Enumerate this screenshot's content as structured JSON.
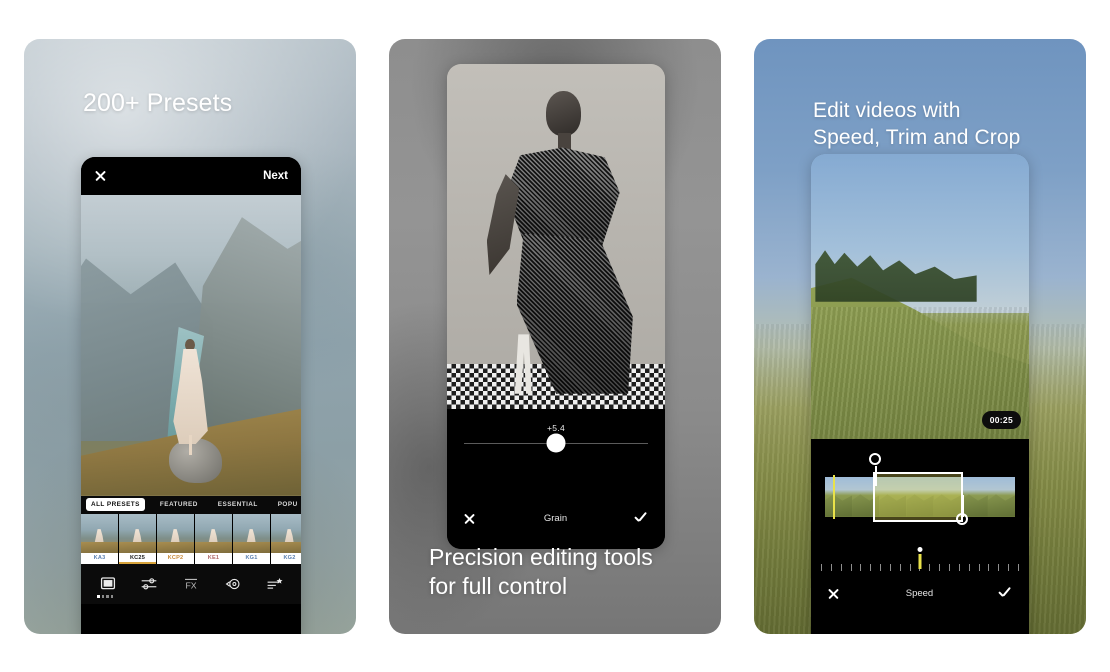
{
  "page": {
    "background": "#ffffff"
  },
  "cards": [
    {
      "id": "presets-card",
      "headline": "200+ Presets",
      "phone": {
        "topbar": {
          "close_icon": "close-icon",
          "next_label": "Next"
        },
        "photo_alt": "Woman in dress standing on rock above fjord",
        "tabs": [
          {
            "label": "ALL PRESETS",
            "active": true
          },
          {
            "label": "FEATURED",
            "active": false
          },
          {
            "label": "ESSENTIAL",
            "active": false
          },
          {
            "label": "POPU",
            "active": false
          }
        ],
        "presets": [
          {
            "label": "KA3",
            "selected": false,
            "tone": "cool"
          },
          {
            "label": "KC25",
            "selected": true,
            "tone": "neutral"
          },
          {
            "label": "KCP2",
            "selected": false,
            "tone": "warm"
          },
          {
            "label": "KE1",
            "selected": false,
            "tone": "rose"
          },
          {
            "label": "KG1",
            "selected": false,
            "tone": "cool"
          },
          {
            "label": "KG2",
            "selected": false,
            "tone": "cool"
          }
        ],
        "toolbar": [
          {
            "icon": "presets-icon"
          },
          {
            "icon": "adjust-sliders-icon"
          },
          {
            "icon": "fx-icon"
          },
          {
            "icon": "history-undo-icon"
          },
          {
            "icon": "favorites-list-icon"
          }
        ],
        "page_dots": 4
      }
    },
    {
      "id": "precision-card",
      "caption_line1": "Precision editing tools",
      "caption_line2": "for full control",
      "phone": {
        "photo_alt": "Black and white portrait of woman in patterned dress",
        "slider": {
          "value": "+5.4",
          "tool_label": "Grain",
          "cancel_icon": "close-icon",
          "confirm_icon": "check-icon",
          "knob_position_pct": 50
        }
      }
    },
    {
      "id": "video-card",
      "headline_line1": "Edit videos with",
      "headline_line2": "Speed, Trim and Crop",
      "phone": {
        "video_alt": "Grassy hillside with blue sky",
        "duration_badge": "00:25",
        "timeline": {
          "handle_start_icon": "trim-handle-start-icon",
          "handle_end_icon": "trim-handle-end-icon",
          "playhead_icon": "playhead-icon"
        },
        "speed": {
          "tool_label": "Speed",
          "cancel_icon": "close-icon",
          "confirm_icon": "check-icon",
          "indicator_position_pct": 50,
          "tick_count": 21
        }
      }
    }
  ],
  "colors": {
    "page_bg": "#ffffff",
    "panel_bg": "#000000",
    "accent_yellow": "#e9e24a",
    "selected_preset_underline": "#d8a43c",
    "text_on_dark": "#ffffff"
  }
}
